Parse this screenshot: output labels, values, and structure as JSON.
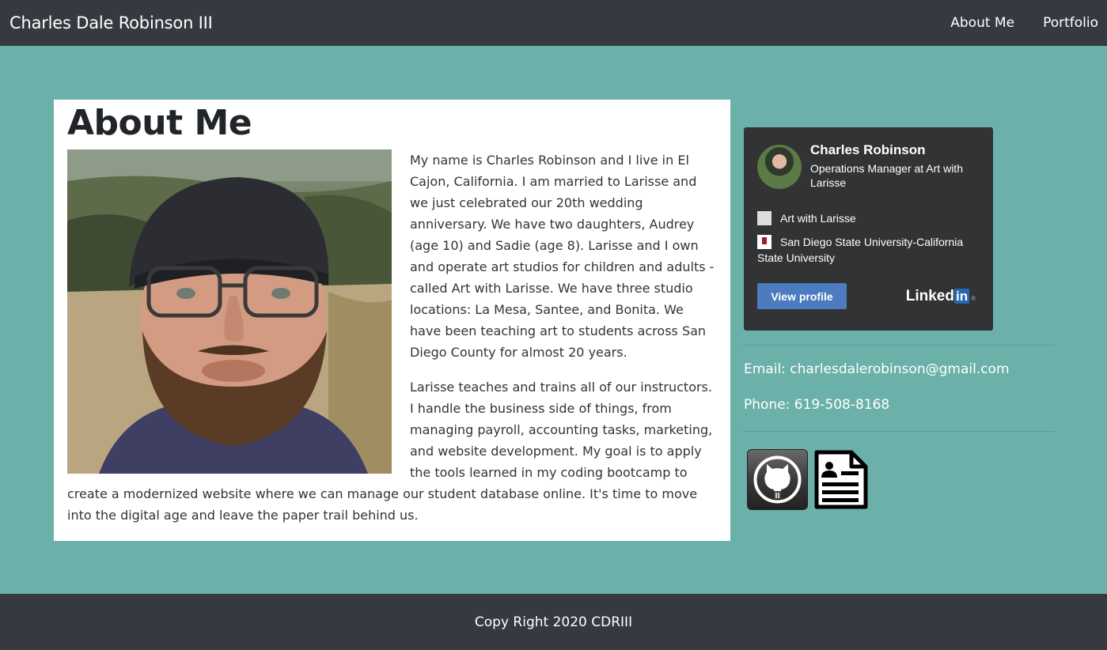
{
  "nav": {
    "brand": "Charles Dale Robinson III",
    "links": [
      "About Me",
      "Portfolio"
    ]
  },
  "about": {
    "title": "About Me",
    "photo_alt": "photo of Charles Robinson",
    "paragraphs": [
      "My name is Charles Robinson and I live in El Cajon, California. I am married to Larisse and we just celebrated our 20th wedding anniversary. We have two daughters, Audrey (age 10) and Sadie (age 8). Larisse and I own and operate art studios for children and adults - called Art with Larisse. We have three studio locations: La Mesa, Santee, and Bonita. We have been teaching art to students across San Diego County for almost 20 years.",
      "Larisse teaches and trains all of our instructors. I handle the business side of things, from managing payroll, accounting tasks, marketing, and website development. My goal is to apply the tools learned in my coding bootcamp to create a modernized website where we can manage our student database online. It's time to move into the digital age and leave the paper trail behind us."
    ]
  },
  "linkedin": {
    "name": "Charles Robinson",
    "headline": "Operations Manager at Art with Larisse",
    "company": "Art with Larisse",
    "school": "San Diego State University-California State University",
    "button": "View profile",
    "logo_text": "Linked",
    "logo_in": "in",
    "logo_mark": "®"
  },
  "contact": {
    "email": "Email: charlesdalerobinson@gmail.com",
    "phone": "Phone: 619-508-8168"
  },
  "footer": {
    "text": "Copy Right 2020 CDRIII"
  },
  "icons": {
    "github": "github-icon",
    "resume": "resume-icon"
  },
  "colors": {
    "background": "#6cb1a9",
    "navbar": "#343a40",
    "linkedin_badge": "#313335",
    "linkedin_button": "#4c7bbf"
  }
}
